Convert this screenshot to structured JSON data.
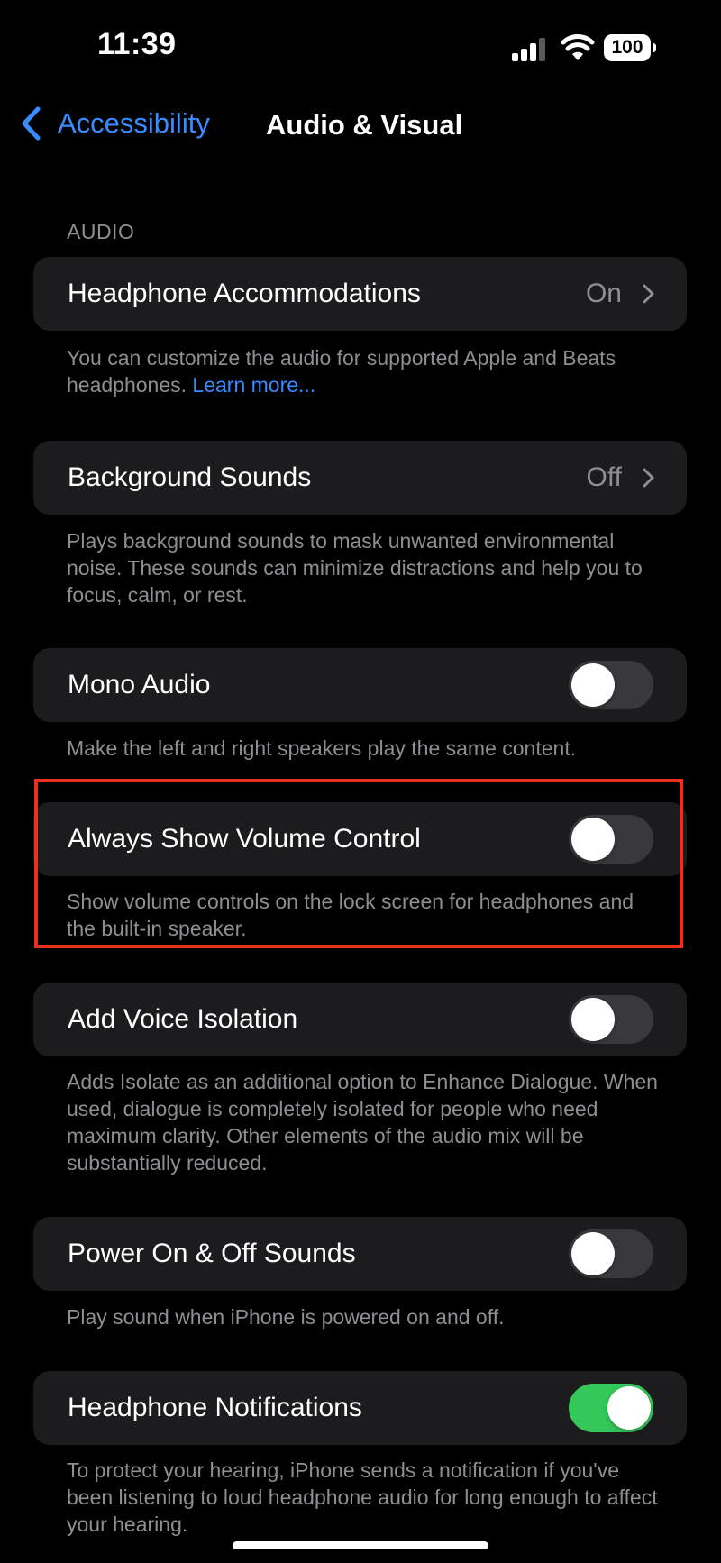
{
  "status_bar": {
    "time": "11:39",
    "battery": "100"
  },
  "nav": {
    "back_label": "Accessibility",
    "title": "Audio & Visual"
  },
  "section_header": "AUDIO",
  "rows": {
    "headphone_accommodations": {
      "label": "Headphone Accommodations",
      "value": "On"
    },
    "headphone_accommodations_footer": {
      "text": "You can customize the audio for supported Apple and Beats headphones. ",
      "link": "Learn more..."
    },
    "background_sounds": {
      "label": "Background Sounds",
      "value": "Off"
    },
    "background_sounds_footer": "Plays background sounds to mask unwanted environmental noise. These sounds can minimize distractions and help you to focus, calm, or rest.",
    "mono_audio": {
      "label": "Mono Audio",
      "enabled": false
    },
    "mono_audio_footer": "Make the left and right speakers play the same content.",
    "always_show_volume": {
      "label": "Always Show Volume Control",
      "enabled": false
    },
    "always_show_volume_footer": "Show volume controls on the lock screen for headphones and the built-in speaker.",
    "voice_isolation": {
      "label": "Add Voice Isolation",
      "enabled": false
    },
    "voice_isolation_footer": "Adds Isolate as an additional option to Enhance Dialogue. When used, dialogue is completely isolated for people who need maximum clarity. Other elements of the audio mix will be substantially reduced.",
    "power_sounds": {
      "label": "Power On & Off Sounds",
      "enabled": false
    },
    "power_sounds_footer": "Play sound when iPhone is powered on and off.",
    "headphone_notifications": {
      "label": "Headphone Notifications",
      "enabled": true
    },
    "headphone_notifications_footer": "To protect your hearing, iPhone sends a notification if you've been listening to loud headphone audio for long enough to affect your hearing."
  },
  "colors": {
    "accent": "#3a8bff",
    "toggle_on": "#34c759",
    "toggle_off": "#39393d",
    "highlight": "#e8321f"
  }
}
